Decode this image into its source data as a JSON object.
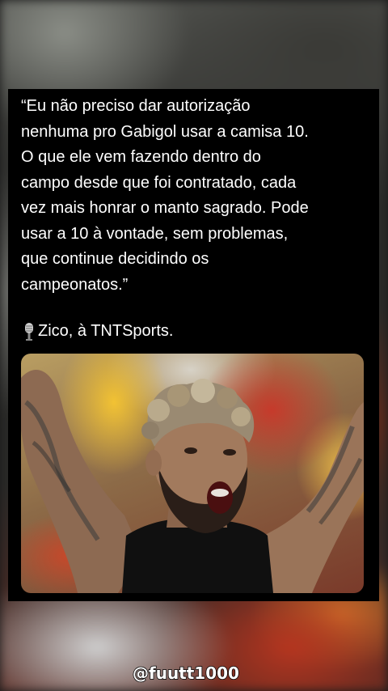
{
  "post": {
    "quote": "“Eu não preciso dar autorização\nnenhuma pro Gabigol usar a camisa 10.\nO que ele vem fazendo dentro do\ncampo desde que foi contratado, cada\nvez mais honrar o manto sagrado. Pode\nusar a 10 à vontade, sem problemas,\nque continue decidindo os\ncampeonatos.”",
    "credit_icon": "microphone-icon",
    "credit_text": "Zico, à TNTSports."
  },
  "watermark": {
    "handle": "@fuutt1000"
  },
  "colors": {
    "card_background": "#000000",
    "text": "#ffffff"
  }
}
